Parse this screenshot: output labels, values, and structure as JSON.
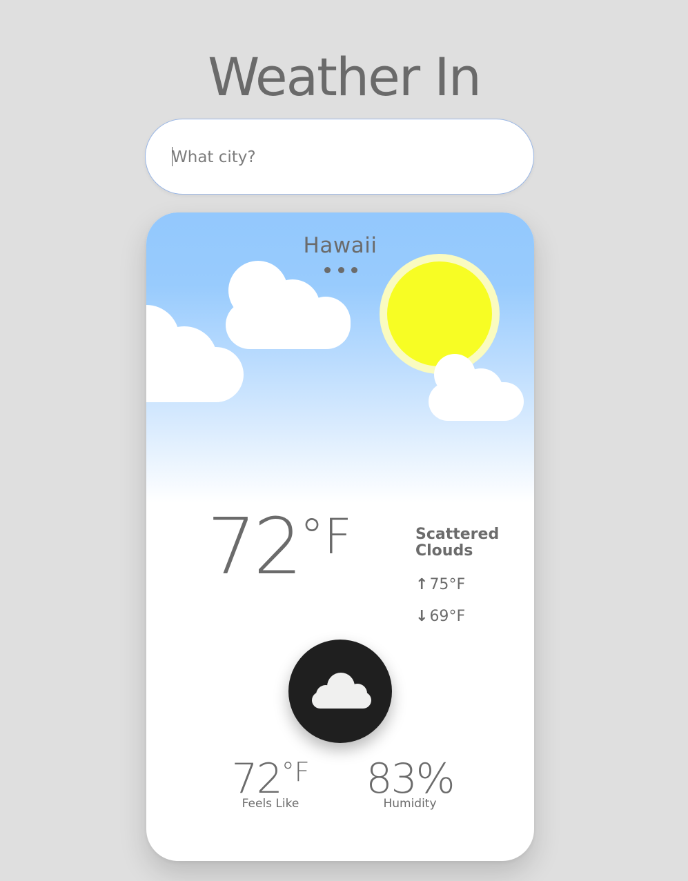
{
  "header": {
    "title": "Weather In"
  },
  "search": {
    "placeholder": "What city?",
    "value": ""
  },
  "weather": {
    "city": "Hawaii",
    "temperature": "72",
    "temperature_unit": "°F",
    "condition": "Scattered Clouds",
    "high": "75",
    "low": "69",
    "high_unit": "°F",
    "low_unit": "°F",
    "condition_icon": "cloud-icon"
  },
  "stats": {
    "feels_like_value": "72",
    "feels_like_unit": "°F",
    "feels_like_label": "Feels Like",
    "humidity_value": "83%",
    "humidity_label": "Humidity"
  },
  "colors": {
    "background": "#dfdfdf",
    "sky_top": "#93c8fd",
    "sun": "#f7fd24",
    "sun_glow": "#fafbc0",
    "icon_circle": "#1f1f1f",
    "text": "#6b6b6b"
  }
}
